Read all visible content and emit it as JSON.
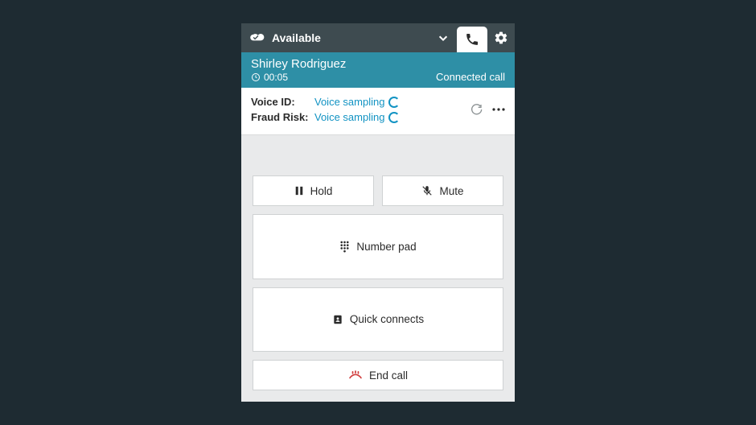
{
  "topbar": {
    "status": "Available"
  },
  "caller": {
    "name": "Shirley Rodriguez",
    "timer": "00:05",
    "status": "Connected call"
  },
  "voice_id": {
    "id_label": "Voice ID:",
    "id_value": "Voice sampling",
    "risk_label": "Fraud Risk:",
    "risk_value": "Voice sampling"
  },
  "buttons": {
    "hold": "Hold",
    "mute": "Mute",
    "number_pad": "Number pad",
    "quick_connects": "Quick connects",
    "end_call": "End call"
  }
}
